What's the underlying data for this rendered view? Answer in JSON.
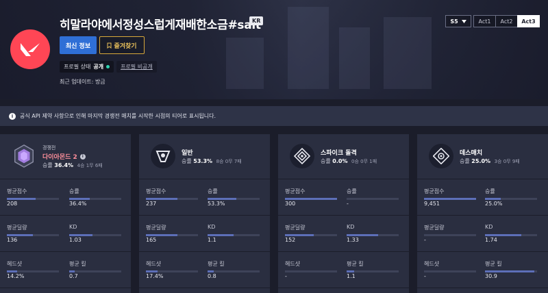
{
  "profile": {
    "name": "히말라야에서정성스럽게재배한소금#salt",
    "region": "KR",
    "latest_button": "최신 정보",
    "favorite_button": "즐겨찾기",
    "status_label": "프로필 상태",
    "status_value": "공개",
    "private_link": "프로필 비공개",
    "updated": "최근 업데이트: 방금"
  },
  "season": {
    "selected": "S5",
    "acts": [
      {
        "label": "Act1",
        "active": false
      },
      {
        "label": "Act2",
        "active": false
      },
      {
        "label": "Act3",
        "active": true
      }
    ]
  },
  "notice": {
    "text": "공식 API 제약 사항으로 인해 마지막 경쟁전 매치를 시작한 시점의 티어로 표시됩니다."
  },
  "colors": {
    "accent_blue": "#2f6fd6",
    "brand_red": "#ff4655",
    "gold": "#d9a93a",
    "rank_pink": "#ff8f9b",
    "bar_fill": "#5d6fb8",
    "status_green": "#2fd3b0"
  },
  "cards": [
    {
      "mode": "경쟁전",
      "rank": "다이아몬드 2",
      "icon": "diamond-rank-icon",
      "win_label": "승률",
      "win_rate": "36.4%",
      "record": "4승 1무 6패",
      "stats": [
        {
          "label": "평균점수",
          "value": "208",
          "fill": 0.55
        },
        {
          "label": "승률",
          "value": "36.4%",
          "fill": 0.4
        },
        {
          "label": "평균딜량",
          "value": "136",
          "fill": 0.5
        },
        {
          "label": "KD",
          "value": "1.03",
          "fill": 0.45
        },
        {
          "label": "헤드샷",
          "value": "14.2%",
          "fill": 0.2
        },
        {
          "label": "평균 킬",
          "value": "0.7",
          "fill": 0.1
        }
      ]
    },
    {
      "mode": "일반",
      "icon": "unrated-mode-icon",
      "win_label": "승률",
      "win_rate": "53.3%",
      "record": "8승 0무 7패",
      "stats": [
        {
          "label": "평균점수",
          "value": "237",
          "fill": 0.6
        },
        {
          "label": "승률",
          "value": "53.3%",
          "fill": 0.55
        },
        {
          "label": "평균딜량",
          "value": "165",
          "fill": 0.6
        },
        {
          "label": "KD",
          "value": "1.1",
          "fill": 0.5
        },
        {
          "label": "헤드샷",
          "value": "17.4%",
          "fill": 0.22
        },
        {
          "label": "평균 킬",
          "value": "0.8",
          "fill": 0.12
        }
      ]
    },
    {
      "mode": "스파이크 돌격",
      "icon": "spike-rush-icon",
      "win_label": "승률",
      "win_rate": "0.0%",
      "record": "0승 0무 1패",
      "stats": [
        {
          "label": "평균점수",
          "value": "300",
          "fill": 1.0
        },
        {
          "label": "승률",
          "value": "-",
          "fill": 0.0
        },
        {
          "label": "평균딜량",
          "value": "152",
          "fill": 0.55
        },
        {
          "label": "KD",
          "value": "1.33",
          "fill": 0.6
        },
        {
          "label": "헤드샷",
          "value": "-",
          "fill": 0.0
        },
        {
          "label": "평균 킬",
          "value": "1.1",
          "fill": 0.15
        }
      ]
    },
    {
      "mode": "데스매치",
      "icon": "deathmatch-icon",
      "win_label": "승률",
      "win_rate": "25.0%",
      "record": "3승 0무 9패",
      "stats": [
        {
          "label": "평균점수",
          "value": "9,451",
          "fill": 1.0
        },
        {
          "label": "승률",
          "value": "25.0%",
          "fill": 0.3
        },
        {
          "label": "평균딜량",
          "value": "-",
          "fill": 0.0
        },
        {
          "label": "KD",
          "value": "1.74",
          "fill": 0.7
        },
        {
          "label": "헤드샷",
          "value": "-",
          "fill": 0.0
        },
        {
          "label": "평균 킬",
          "value": "30.9",
          "fill": 0.95
        }
      ]
    }
  ]
}
